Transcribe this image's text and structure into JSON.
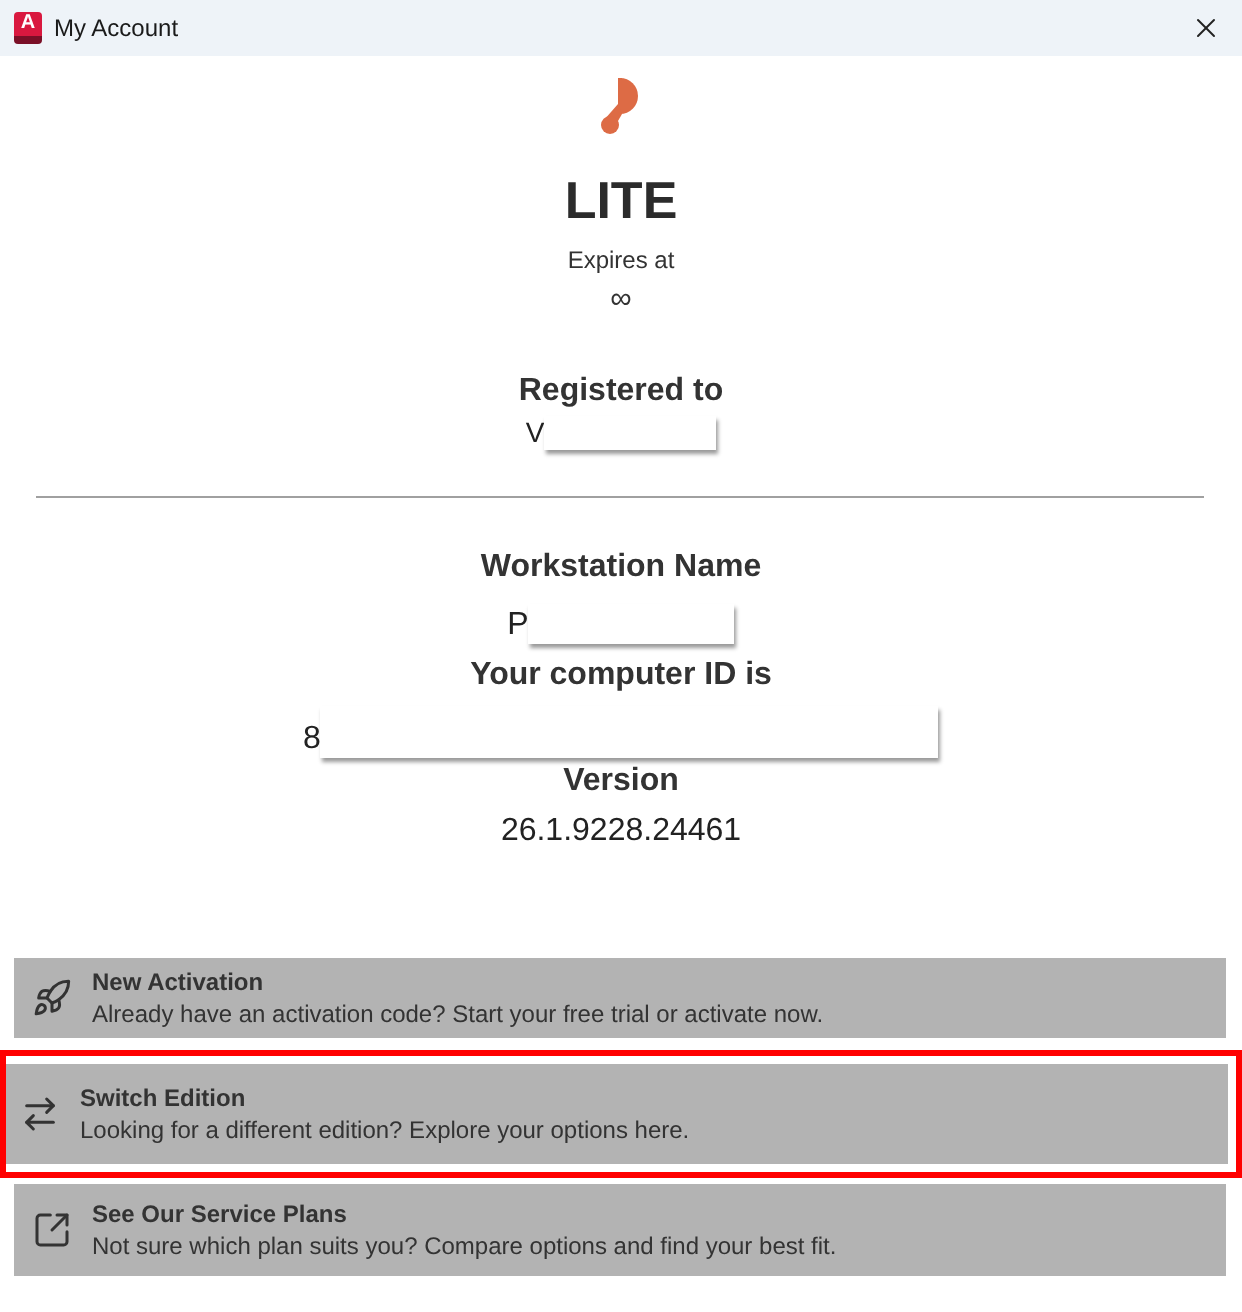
{
  "window": {
    "title": "My Account",
    "icon_letter": "A"
  },
  "plan": {
    "name": "LITE",
    "expires_label": "Expires at",
    "expires_value": "∞"
  },
  "sections": [
    {
      "fields": [
        {
          "label": "Registered to",
          "value": "V",
          "redacted": true
        }
      ]
    },
    {
      "fields": [
        {
          "label": "Workstation Name",
          "value": "P",
          "redacted": true
        },
        {
          "label": "Your computer ID is",
          "value": "8",
          "redacted": true
        },
        {
          "label": "Version",
          "value": "26.1.9228.24461",
          "redacted": false
        }
      ]
    }
  ],
  "actions": [
    {
      "kind": "rocket",
      "title": "New Activation",
      "description": "Already have an activation code? Start your free trial or activate now.",
      "highlighted": false
    },
    {
      "kind": "switch",
      "title": "Switch Edition",
      "description": "Looking for a different edition? Explore your options here.",
      "highlighted": true
    },
    {
      "kind": "external",
      "title": "See Our Service Plans",
      "description": "Not sure which plan suits you? Compare options and find your best fit.",
      "highlighted": false
    }
  ]
}
